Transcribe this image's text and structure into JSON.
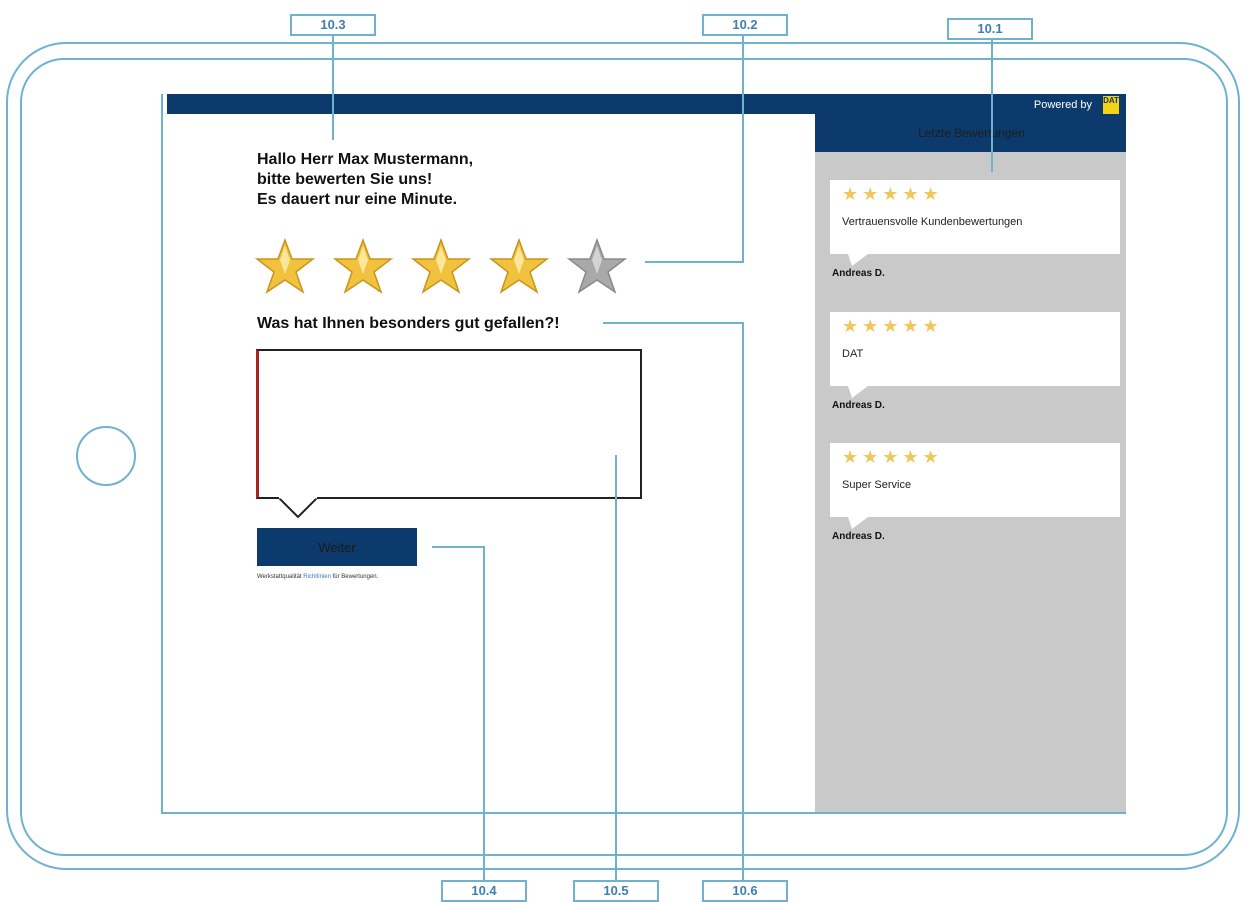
{
  "header": {
    "powered_by": "Powered by",
    "logo_text": "DAT"
  },
  "form": {
    "greeting_lines": [
      "Hallo Herr Max Mustermann,",
      "bitte bewerten Sie uns!",
      "Es dauert nur eine Minute."
    ],
    "rating": {
      "value": 4,
      "max": 5
    },
    "question": "Was hat Ihnen besonders gut gefallen?!",
    "comment_value": "",
    "submit_label": "Weiter",
    "guideline": {
      "before": "Werkstattqualität",
      "link": "Richtlinien",
      "after": "für Bewertungen."
    }
  },
  "sidebar": {
    "title": "Letzte Bewertungen",
    "reviews": [
      {
        "stars": 5,
        "text": "Vertrauensvolle Kundenbewertungen",
        "author": "Andreas D."
      },
      {
        "stars": 5,
        "text": "DAT",
        "author": "Andreas D."
      },
      {
        "stars": 5,
        "text": "Super Service",
        "author": "Andreas D."
      }
    ]
  },
  "annotations": [
    "10.1",
    "10.2",
    "10.3",
    "10.4",
    "10.5",
    "10.6"
  ],
  "colors": {
    "navy": "#0c3a6c",
    "frame": "#6fb2cf",
    "star_gold": "#f0c75a",
    "sidebar_bg": "#c9c9c9"
  }
}
